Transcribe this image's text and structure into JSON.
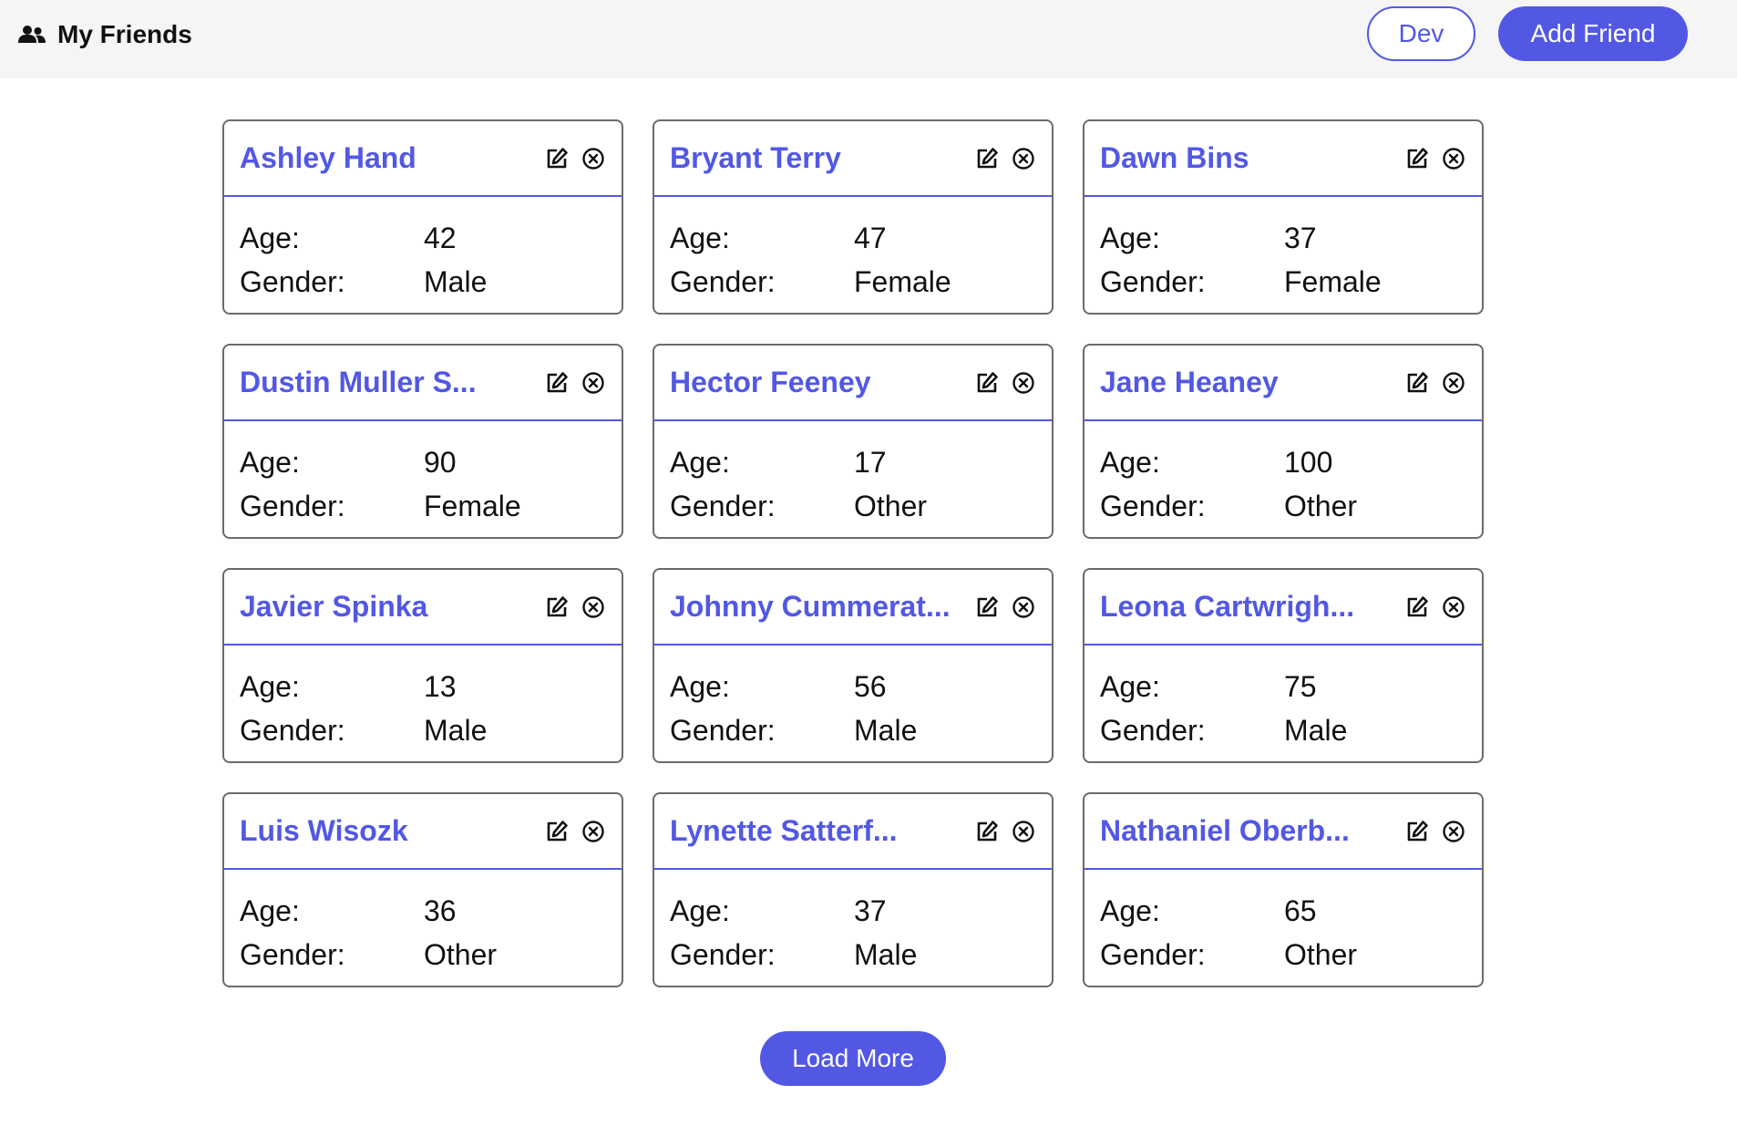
{
  "header": {
    "title": "My Friends",
    "icon": "users-icon",
    "dev_label": "Dev",
    "add_friend_label": "Add Friend"
  },
  "labels": {
    "age": "Age:",
    "gender": "Gender:"
  },
  "friends": [
    {
      "name": "Ashley Hand",
      "age": "42",
      "gender": "Male"
    },
    {
      "name": "Bryant Terry",
      "age": "47",
      "gender": "Female"
    },
    {
      "name": "Dawn Bins",
      "age": "37",
      "gender": "Female"
    },
    {
      "name": "Dustin Muller S...",
      "age": "90",
      "gender": "Female"
    },
    {
      "name": "Hector Feeney",
      "age": "17",
      "gender": "Other"
    },
    {
      "name": "Jane Heaney",
      "age": "100",
      "gender": "Other"
    },
    {
      "name": "Javier Spinka",
      "age": "13",
      "gender": "Male"
    },
    {
      "name": "Johnny Cummerat...",
      "age": "56",
      "gender": "Male"
    },
    {
      "name": "Leona Cartwrigh...",
      "age": "75",
      "gender": "Male"
    },
    {
      "name": "Luis Wisozk",
      "age": "36",
      "gender": "Other"
    },
    {
      "name": "Lynette Satterf...",
      "age": "37",
      "gender": "Male"
    },
    {
      "name": "Nathaniel Oberb...",
      "age": "65",
      "gender": "Other"
    }
  ],
  "card_icons": {
    "edit": "edit-icon",
    "delete": "close-circle-icon"
  },
  "footer": {
    "load_more_label": "Load More"
  },
  "colors": {
    "accent": "#5258e4",
    "header_bg": "#f5f5f5",
    "card_border": "#6b6b6b",
    "text": "#111111"
  }
}
